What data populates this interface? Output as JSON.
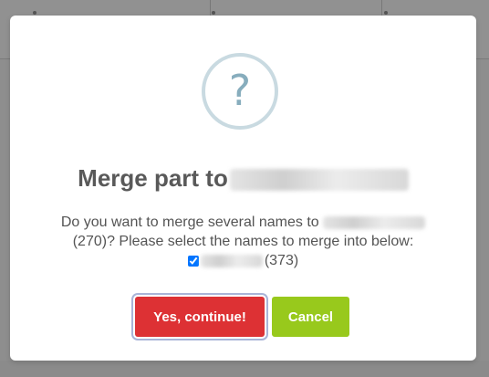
{
  "dialog": {
    "icon": "question-icon",
    "icon_glyph": "?",
    "title": "Merge part to",
    "message_line1": "Do you want to merge several names to",
    "message_line2": "(270)? Please select the names to merge into below:",
    "option_count": "(373)",
    "option_checked": true,
    "confirm_label": "Yes, continue!",
    "cancel_label": "Cancel"
  },
  "colors": {
    "confirm": "#dd3134",
    "cancel": "#98c91c",
    "icon_ring": "#c9dae1",
    "icon_glyph": "#87adbd"
  }
}
